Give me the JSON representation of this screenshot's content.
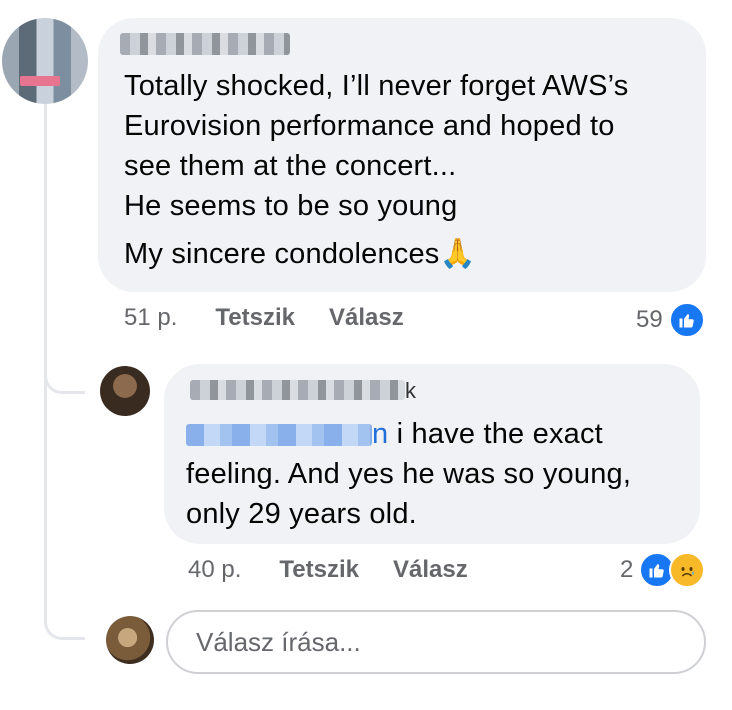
{
  "comment": {
    "lines": [
      "Totally shocked, I’ll never forget AWS’s",
      "Eurovision performance and hoped to",
      "see them at the concert...",
      "He seems to be so young"
    ],
    "last_line": "My sincere condolences",
    "emoji": "🙏",
    "time": "51 p.",
    "like_label": "Tetszik",
    "reply_label": "Válasz",
    "reaction_count": "59",
    "reaction_icon": "like-icon"
  },
  "reply": {
    "name_tail": "k",
    "mention_tail": "n",
    "text_lines": [
      " i have the exact",
      "feeling. And yes he was so young,",
      "only 29 years old."
    ],
    "time": "40 p.",
    "like_label": "Tetszik",
    "reply_label": "Válasz",
    "reaction_count": "2",
    "reaction_icons": [
      "like-icon",
      "sad-icon"
    ]
  },
  "composer": {
    "placeholder": "Válasz írása..."
  },
  "colors": {
    "bubble": "#f0f2f5",
    "meta_text": "#65676b",
    "like_blue": "#1877f2",
    "mention_blue": "#216fdb"
  }
}
